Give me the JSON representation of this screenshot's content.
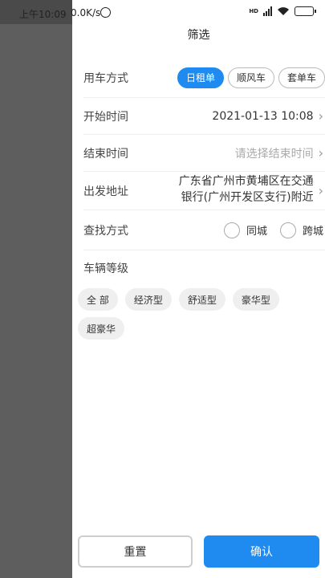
{
  "status_bar": {
    "time": "上午10:09",
    "network_speed": "0.0K/s",
    "network_type": "HD",
    "icons": [
      "alarm-icon",
      "signal-icon",
      "wifi-icon",
      "battery-icon"
    ]
  },
  "drawer": {
    "title": "筛选",
    "mode": {
      "label": "用车方式",
      "options": [
        "日租单",
        "顺风车",
        "套单车"
      ],
      "selected": "日租单"
    },
    "start_time": {
      "label": "开始时间",
      "value": "2021-01-13 10:08"
    },
    "end_time": {
      "label": "结束时间",
      "placeholder": "请选择结束时间"
    },
    "departure": {
      "label": "出发地址",
      "value": "广东省广州市黄埔区在交通银行(广州开发区支行)附近"
    },
    "search_mode": {
      "label": "查找方式",
      "options": [
        "同城",
        "跨城"
      ]
    },
    "vehicle_grade": {
      "label": "车辆等级",
      "options": [
        "全 部",
        "经济型",
        "舒适型",
        "豪华型",
        "超豪华"
      ]
    },
    "actions": {
      "reset": "重置",
      "confirm": "确认"
    }
  },
  "colors": {
    "accent": "#1f8bf0",
    "chip_bg": "#efefef",
    "overlay": "#5e5e5e"
  }
}
